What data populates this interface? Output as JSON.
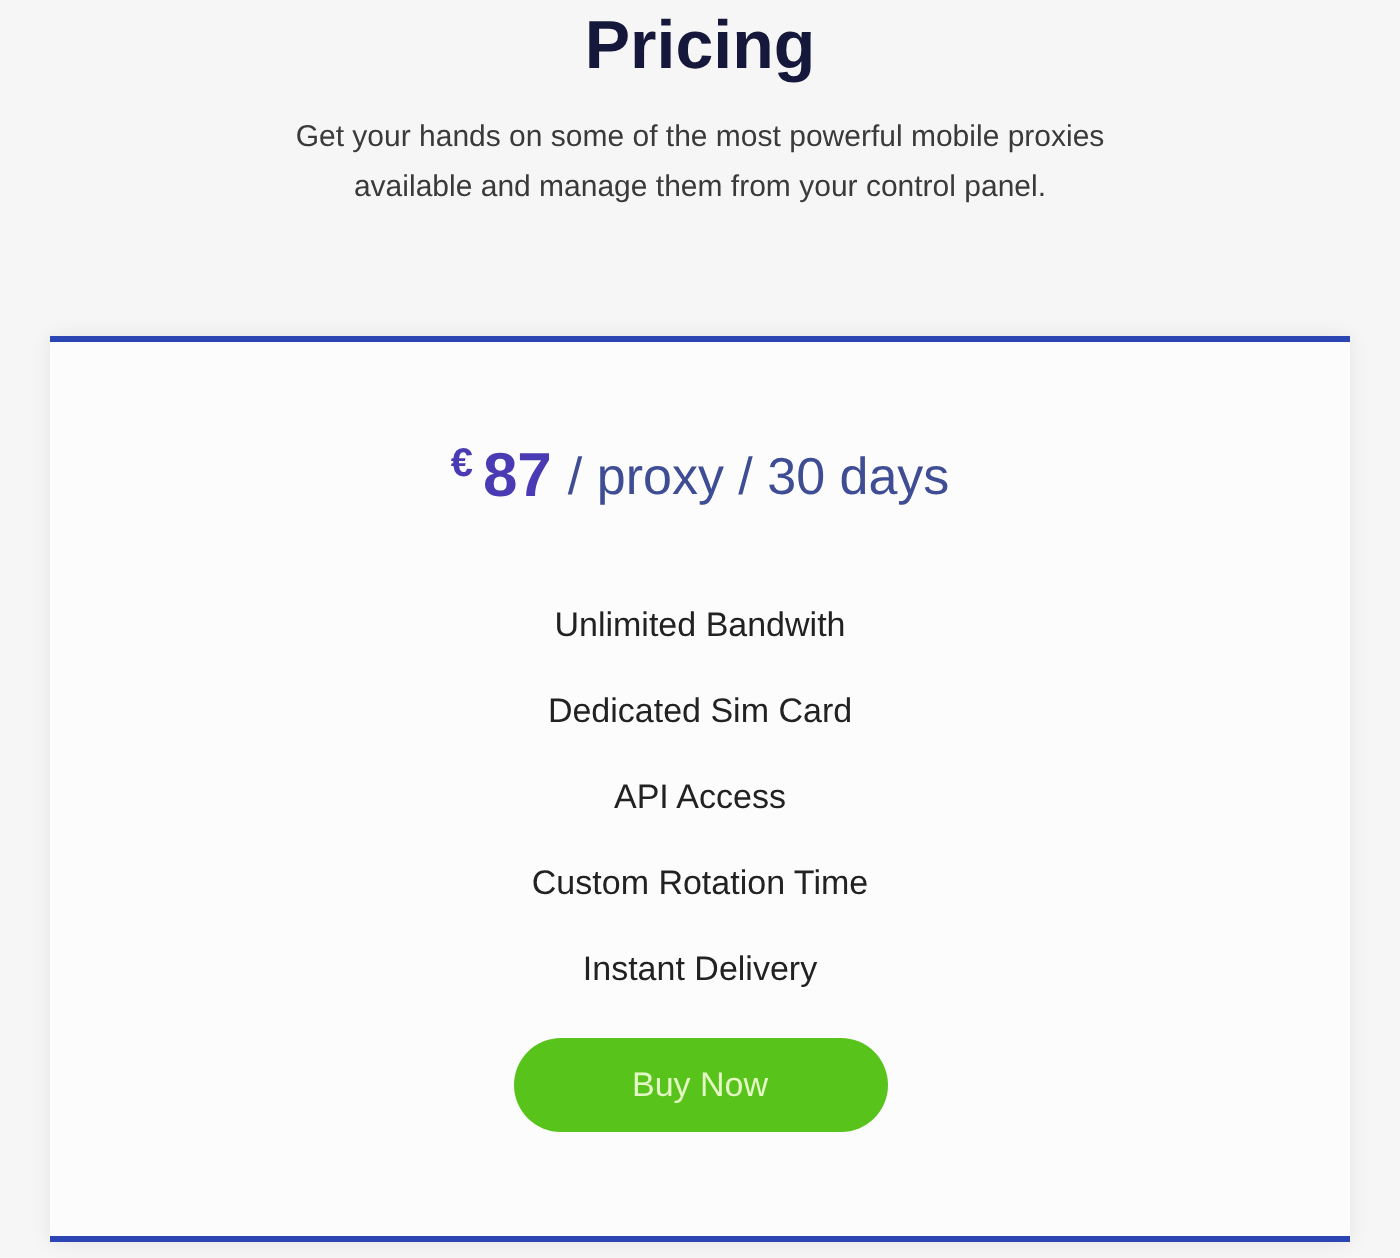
{
  "header": {
    "title": "Pricing",
    "subtitle": "Get your hands on some of the most powerful mobile proxies available and manage them from your control panel."
  },
  "plan": {
    "currency": "€",
    "amount": "87",
    "period": "/ proxy / 30 days",
    "features": [
      "Unlimited Bandwith",
      "Dedicated Sim Card",
      "API Access",
      "Custom Rotation Time",
      "Instant Delivery"
    ],
    "button": "Buy Now"
  }
}
